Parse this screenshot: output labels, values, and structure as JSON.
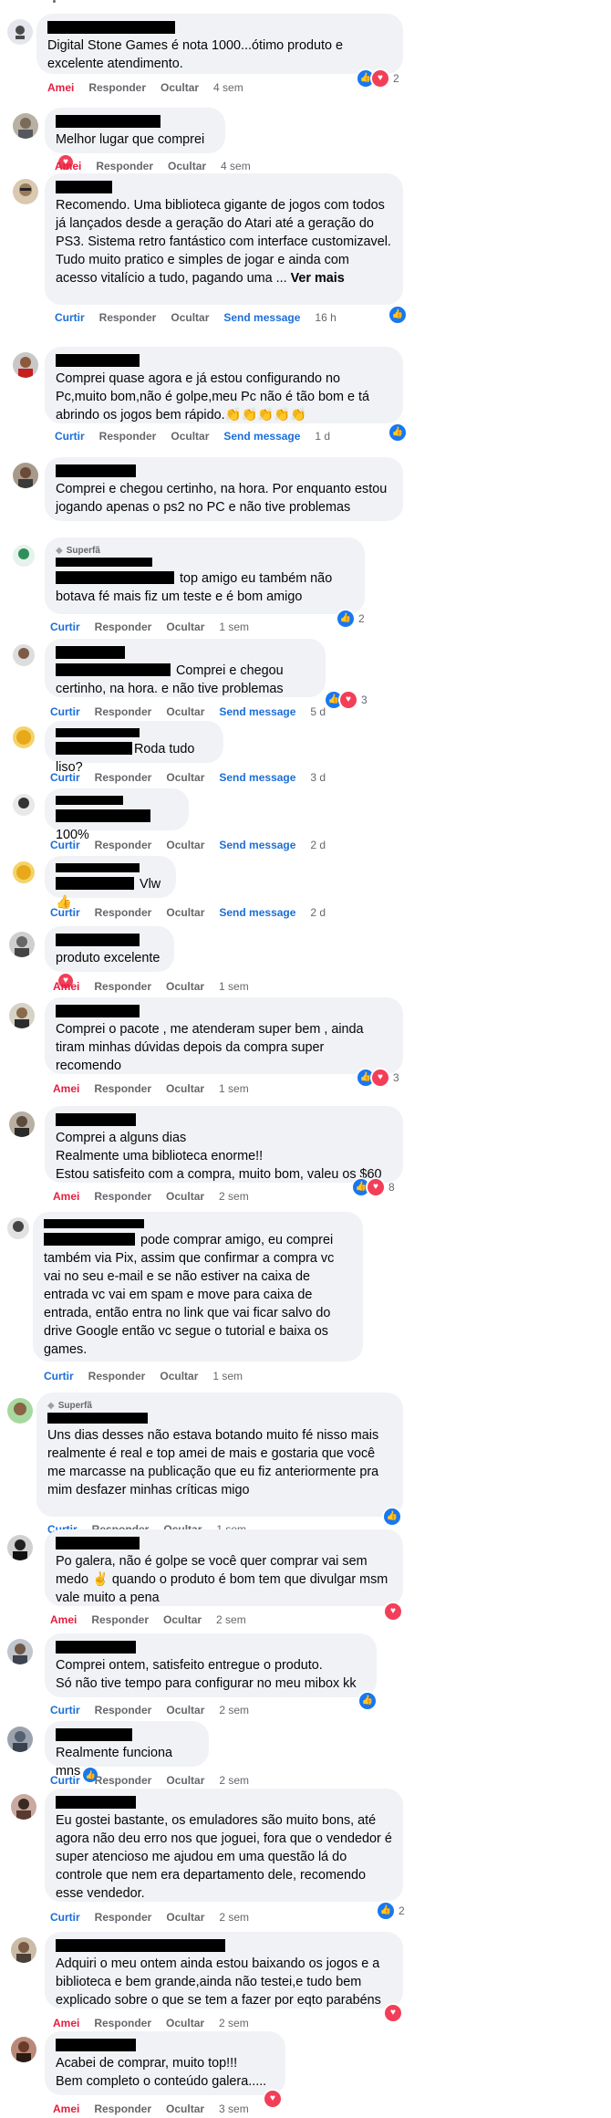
{
  "labels": {
    "amei": "Amei",
    "curtir": "Curtir",
    "responder": "Responder",
    "ocultar": "Ocultar",
    "send": "Send message",
    "superfa": "Superfã"
  },
  "comments": [
    {
      "text": "Digital Stone Games é nota 1000...ótimo produto e excelente atendimento.",
      "action": "Amei",
      "send": false,
      "time": "4 sem",
      "reactions": [
        "like",
        "love"
      ],
      "count": "2"
    },
    {
      "text": "Melhor lugar que comprei",
      "action": "Amei",
      "send": false,
      "time": "4 sem",
      "inline": "heart"
    },
    {
      "text": "Recomendo. Uma biblioteca gigante de jogos com todos já lançados desde a geração do Atari até a geração do PS3. Sistema retro fantástico com interface customizavel. Tudo muito pratico e simples de jogar e ainda com acesso vitalício a tudo, pagando uma ... ",
      "more": "Ver mais",
      "action": "Curtir",
      "send": true,
      "time": "16 h",
      "reactions": [
        "like"
      ]
    },
    {
      "text": "Comprei quase agora e já estou configurando no Pc,muito bom,não é golpe,meu Pc não é tão bom e tá abrindo os jogos bem rápido.👏👏👏👏👏",
      "action": "Curtir",
      "send": true,
      "time": "1 d",
      "reactions": [
        "like"
      ]
    },
    {
      "text": "Comprei e chegou certinho, na hora. Por enquanto estou jogando apenas o ps2 no PC e não tive problemas",
      "action": "",
      "send": false,
      "time": ""
    },
    {
      "badge": "Superfã",
      "text": " top amigo eu também não botava fé mais fiz um teste e é bom amigo",
      "action": "Curtir",
      "send": false,
      "time": "1 sem",
      "reactions": [
        "like"
      ],
      "count": "2"
    },
    {
      "text": " Comprei e chegou certinho, na hora. e não tive problemas",
      "action": "Curtir",
      "send": true,
      "time": "5 d",
      "reactions": [
        "like",
        "love"
      ],
      "count": "3"
    },
    {
      "text": "Roda tudo liso?",
      "action": "Curtir",
      "send": true,
      "time": "3 d"
    },
    {
      "text": "100%",
      "action": "Curtir",
      "send": true,
      "time": "2 d"
    },
    {
      "text": " Vlw👍",
      "action": "Curtir",
      "send": true,
      "time": "2 d"
    },
    {
      "text": "produto excelente",
      "action": "Amei",
      "send": false,
      "time": "1 sem",
      "inline": "heart"
    },
    {
      "text": "Comprei o pacote , me atenderam super bem , ainda tiram minhas dúvidas depois da compra super recomendo",
      "action": "Amei",
      "send": false,
      "time": "1 sem",
      "reactions": [
        "like",
        "love"
      ],
      "count": "3"
    },
    {
      "text": "Comprei a alguns dias\nRealmente uma biblioteca enorme!!\nEstou satisfeito com a compra, muito bom, valeu os $60",
      "action": "Amei",
      "send": false,
      "time": "2 sem",
      "reactions": [
        "like",
        "love"
      ],
      "count": "8"
    },
    {
      "text": " pode comprar amigo, eu comprei também via Pix, assim que confirmar a compra vc vai no seu e-mail e se não estiver na caixa de entrada vc vai em spam e move para caixa de entrada, então entra no link que vai ficar salvo do drive Google então vc segue o tutorial e baixa os games.",
      "action": "Curtir",
      "send": false,
      "time": "1 sem"
    },
    {
      "badge": "Superfã",
      "text": "Uns dias desses não estava botando muito fé nisso mais realmente é real e top amei de mais e gostaria que você me marcasse na publicação que eu fiz anteriormente pra mim desfazer minhas críticas migo",
      "action": "Curtir",
      "send": false,
      "time": "1 sem",
      "reactions": [
        "like"
      ]
    },
    {
      "text": "Po galera, não é golpe se você quer comprar vai sem medo ✌️ quando o produto é bom tem que divulgar msm vale muito a pena",
      "action": "Amei",
      "send": false,
      "time": "2 sem",
      "reactions": [
        "love"
      ]
    },
    {
      "text": "Comprei ontem, satisfeito entregue o produto.\nSó não tive tempo para configurar no meu mibox kk",
      "action": "Curtir",
      "send": false,
      "time": "2 sem",
      "reactions": [
        "like"
      ]
    },
    {
      "text": "Realmente funciona mns",
      "action": "Curtir",
      "send": false,
      "time": "2 sem",
      "inline": "like"
    },
    {
      "text": "Eu gostei bastante, os emuladores são muito bons, até agora não deu erro nos que joguei, fora que o vendedor é super atencioso me ajudou em uma questão lá do controle que nem era departamento dele, recomendo esse vendedor.",
      "action": "Curtir",
      "send": false,
      "time": "2 sem",
      "reactions": [
        "like"
      ],
      "count": "2"
    },
    {
      "text": "Adquiri o meu ontem ainda estou baixando os jogos e a biblioteca e bem grande,ainda não testei,e tudo bem explicado sobre o que se tem a fazer por eqto parabéns",
      "action": "Amei",
      "send": false,
      "time": "2 sem",
      "reactions": [
        "love"
      ]
    },
    {
      "text": "Acabei de comprar, muito top!!!\nBem completo o conteúdo galera.....",
      "action": "Amei",
      "send": false,
      "time": "3 sem",
      "reactions": [
        "love"
      ]
    }
  ]
}
